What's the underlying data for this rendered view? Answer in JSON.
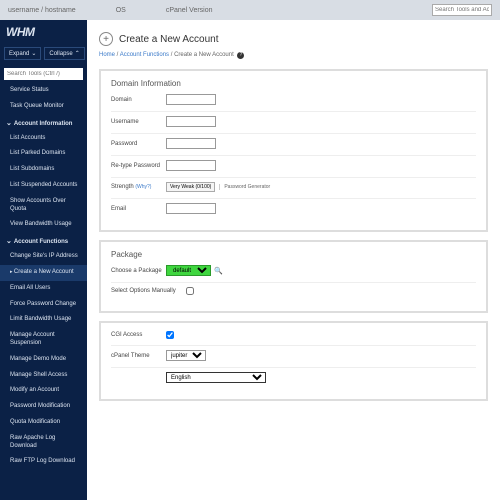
{
  "topbar": {
    "items": [
      "username / hostname",
      "OS",
      "cPanel Version"
    ],
    "search_placeholder": "Search Tools and Accounts ("
  },
  "brand": "WHM",
  "buttons": {
    "expand": "Expand",
    "collapse": "Collapse"
  },
  "side_search_placeholder": "Search Tools (Ctrl /)",
  "menu": {
    "top": [
      "Service Status",
      "Task Queue Monitor"
    ],
    "sec1": {
      "head": "Account Information",
      "items": [
        "List Accounts",
        "List Parked Domains",
        "List Subdomains",
        "List Suspended Accounts",
        "Show Accounts Over Quota",
        "View Bandwidth Usage"
      ]
    },
    "sec2": {
      "head": "Account Functions",
      "items": [
        "Change Site's IP Address",
        "Create a New Account",
        "Email All Users",
        "Force Password Change",
        "Limit Bandwidth Usage",
        "Manage Account Suspension",
        "Manage Demo Mode",
        "Manage Shell Access",
        "Modify an Account",
        "Password Modification",
        "Quota Modification",
        "Raw Apache Log Download",
        "Raw FTP Log Download"
      ]
    }
  },
  "page": {
    "title": "Create a New Account",
    "crumb_home": "Home",
    "crumb_sec": "Account Functions",
    "crumb_cur": "Create a New Account"
  },
  "domainInfo": {
    "heading": "Domain Information",
    "domain": "Domain",
    "username": "Username",
    "password": "Password",
    "repass": "Re-type Password",
    "strength": "Strength",
    "why": "(Why?)",
    "strength_val": "Very Weak (0/100)",
    "pgen": "Password Generator",
    "email": "Email"
  },
  "pkg": {
    "heading": "Package",
    "choose": "Choose a Package",
    "default": "default",
    "manual": "Select Options Manually"
  },
  "settings": {
    "cgi": "CGI Access",
    "theme": "cPanel Theme",
    "theme_val": "jupiter",
    "lang_val": "English"
  }
}
